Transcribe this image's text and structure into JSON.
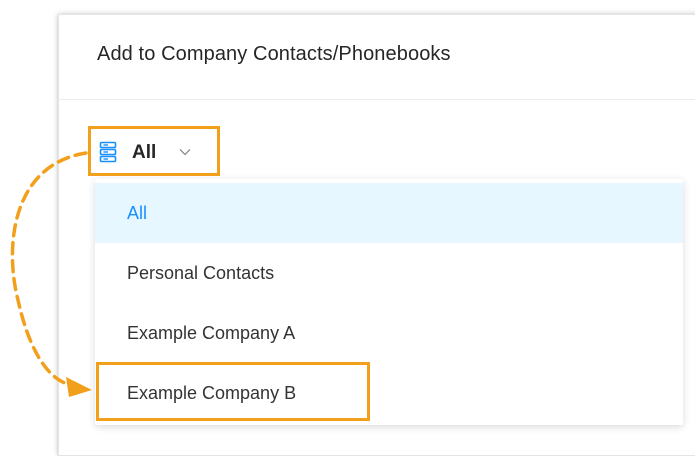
{
  "dialog": {
    "title": "Add to Company Contacts/Phonebooks"
  },
  "filter": {
    "selected_label": "All",
    "icon": "phonebook-stack-icon",
    "chevron": "chevron-down-icon"
  },
  "menu": {
    "items": [
      {
        "label": "All",
        "selected": true
      },
      {
        "label": "Personal Contacts",
        "selected": false
      },
      {
        "label": "Example Company A",
        "selected": false
      },
      {
        "label": "Example Company B",
        "selected": false
      }
    ]
  },
  "colors": {
    "highlight": "#f2a01c",
    "accent": "#1890ff",
    "selected_bg": "#e6f7ff",
    "text": "#262626"
  }
}
